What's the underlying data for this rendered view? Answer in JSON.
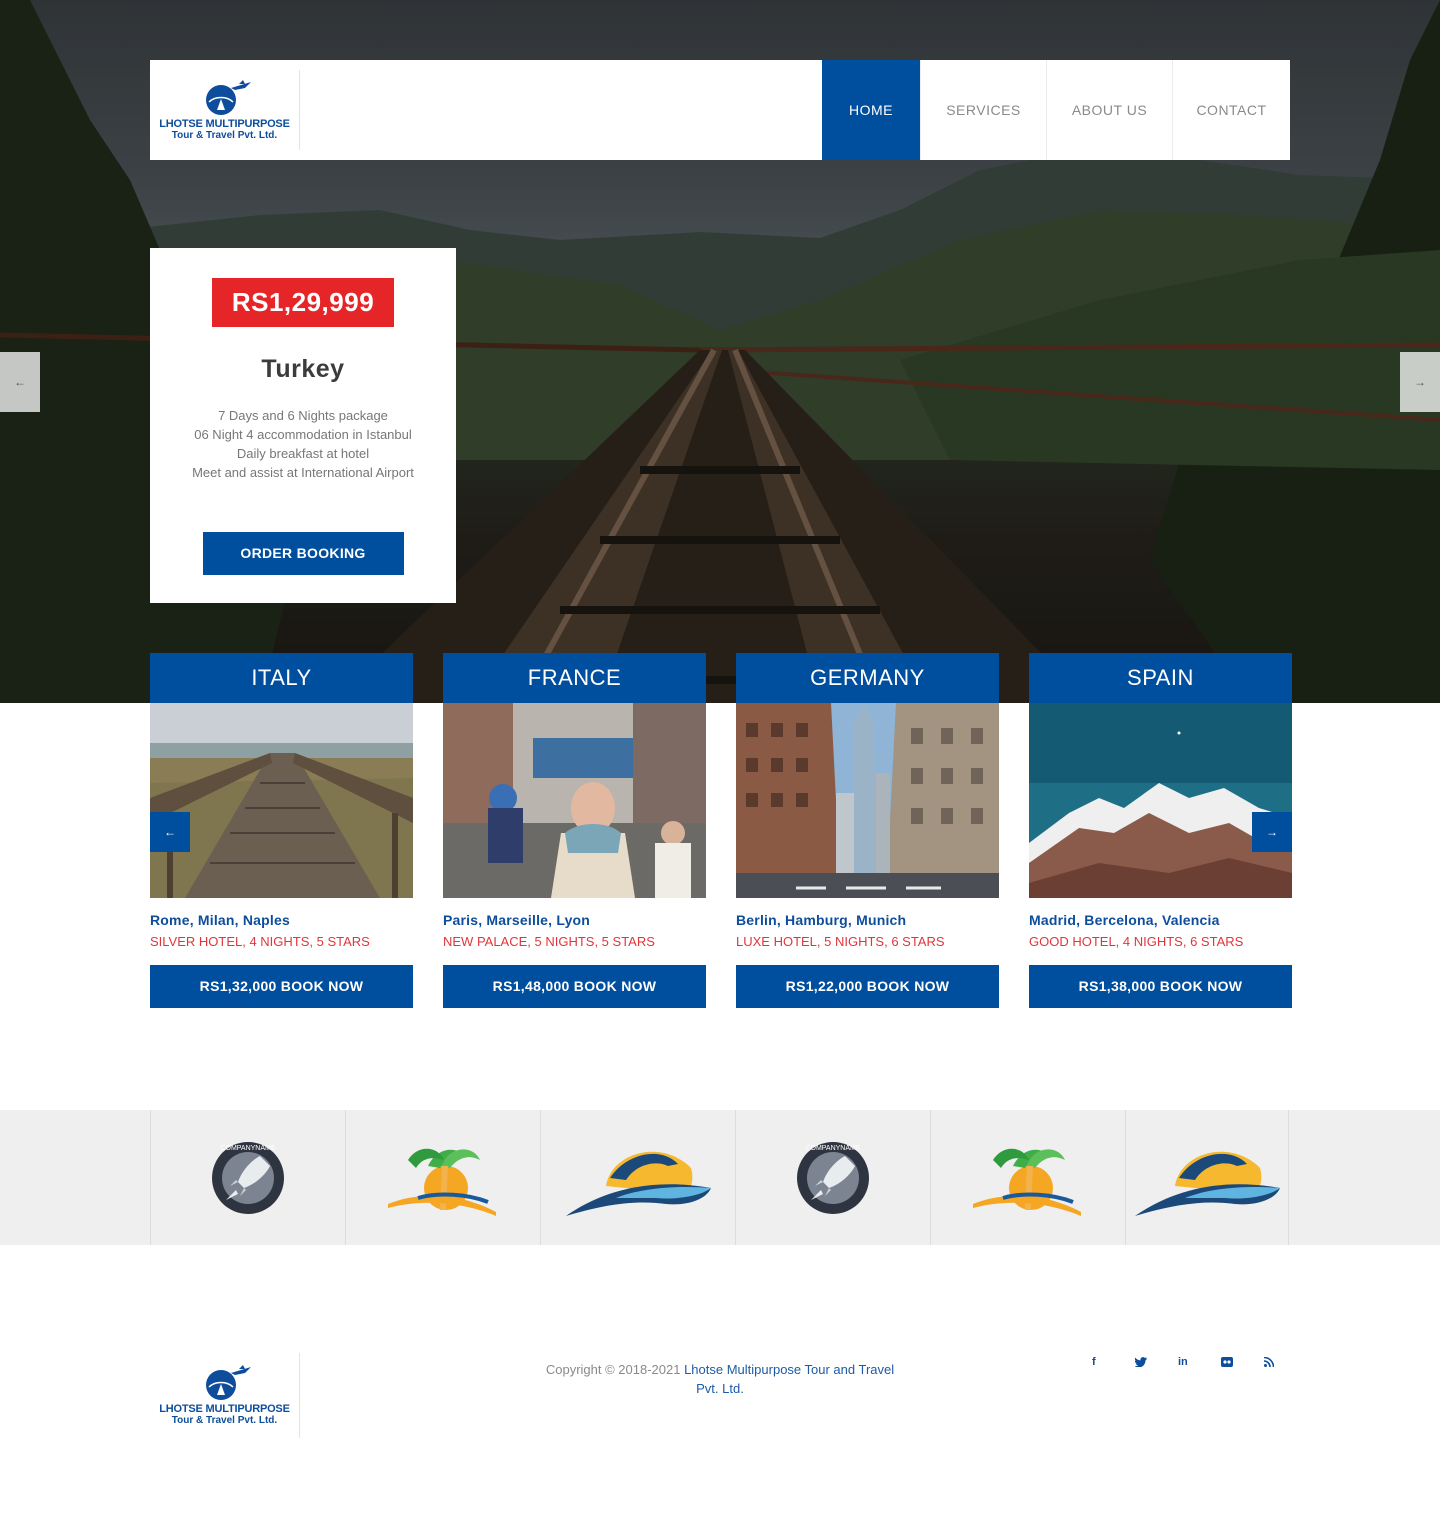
{
  "brand": {
    "name_line1": "LHOTSE MULTIPURPOSE",
    "name_line2": "Tour & Travel Pvt. Ltd.",
    "primary_color": "#004e9e",
    "accent_color": "#e52528"
  },
  "nav": {
    "items": [
      {
        "label": "HOME",
        "active": true
      },
      {
        "label": "SERVICES",
        "active": false
      },
      {
        "label": "ABOUT US",
        "active": false
      },
      {
        "label": "CONTACT",
        "active": false
      }
    ]
  },
  "hero": {
    "prev_arrow": "←",
    "next_arrow": "→"
  },
  "package": {
    "price": "RS1,29,999",
    "title": "Turkey",
    "features": [
      "7 Days and 6 Nights package",
      "06 Night 4 accommodation in Istanbul",
      "Daily breakfast at hotel",
      "Meet and assist at International Airport"
    ],
    "button_label": "ORDER BOOKING"
  },
  "destinations": [
    {
      "country": "ITALY",
      "cities": "Rome, Milan, Naples",
      "hotel": "SILVER HOTEL, 4 NIGHTS, 5 STARS",
      "button": "RS1,32,000 BOOK NOW"
    },
    {
      "country": "FRANCE",
      "cities": "Paris, Marseille, Lyon",
      "hotel": "NEW PALACE, 5 NIGHTS, 5 STARS",
      "button": "RS1,48,000 BOOK NOW"
    },
    {
      "country": "GERMANY",
      "cities": "Berlin, Hamburg, Munich",
      "hotel": "LUXE HOTEL, 5 NIGHTS, 6 STARS",
      "button": "RS1,22,000 BOOK NOW"
    },
    {
      "country": "SPAIN",
      "cities": "Madrid, Bercelona, Valencia",
      "hotel": "GOOD HOTEL, 4 NIGHTS, 6 STARS",
      "button": "RS1,38,000 BOOK NOW"
    }
  ],
  "carousel": {
    "prev_arrow": "←",
    "next_arrow": "→"
  },
  "partners": [
    {
      "icon": "rocket-badge-logo",
      "badge_text": "COMPANYNAME"
    },
    {
      "icon": "palm-island-logo"
    },
    {
      "icon": "dolphin-wave-logo"
    },
    {
      "icon": "rocket-badge-logo",
      "badge_text": "COMPANYNAME"
    },
    {
      "icon": "palm-island-logo"
    },
    {
      "icon": "dolphin-wave-logo"
    }
  ],
  "footer": {
    "copyright_prefix": "Copyright © 2018-2021 ",
    "company_link": "Lhotse Multipurpose Tour and Travel Pvt. Ltd.",
    "social": [
      {
        "icon": "facebook-icon",
        "glyph": "f"
      },
      {
        "icon": "twitter-icon",
        "glyph": "🐦"
      },
      {
        "icon": "linkedin-icon",
        "glyph": "in"
      },
      {
        "icon": "flickr-icon",
        "glyph": "••"
      },
      {
        "icon": "rss-icon",
        "glyph": "))"
      }
    ]
  }
}
